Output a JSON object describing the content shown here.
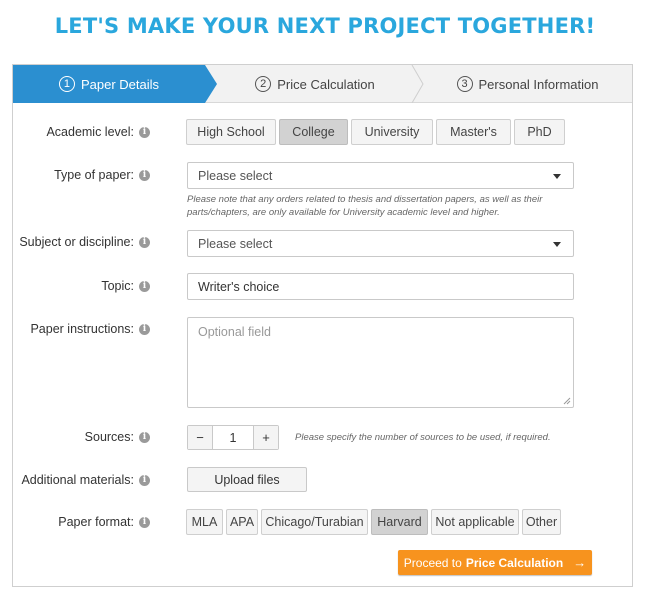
{
  "headline": "LET'S MAKE YOUR NEXT PROJECT TOGETHER!",
  "steps": [
    {
      "num": "1",
      "label": "Paper Details"
    },
    {
      "num": "2",
      "label": "Price Calculation"
    },
    {
      "num": "3",
      "label": "Personal Information"
    }
  ],
  "info_glyph": "i",
  "academic_level": {
    "label": "Academic level:",
    "options": [
      "High School",
      "College",
      "University",
      "Master's",
      "PhD"
    ],
    "selected": "College"
  },
  "type_of_paper": {
    "label": "Type of paper:",
    "value": "Please select",
    "note_line1": "Please note that any orders related to thesis and dissertation papers, as well as their",
    "note_line2": "parts/chapters, are only available for University academic level and higher."
  },
  "subject": {
    "label": "Subject or discipline:",
    "value": "Please select"
  },
  "topic": {
    "label": "Topic:",
    "value": "Writer's choice"
  },
  "instructions": {
    "label": "Paper instructions:",
    "placeholder": "Optional field"
  },
  "sources": {
    "label": "Sources:",
    "minus": "−",
    "value": "1",
    "plus": "+",
    "hint": "Please specify the number of sources to be used, if required."
  },
  "additional_materials": {
    "label": "Additional materials:",
    "button": "Upload files"
  },
  "paper_format": {
    "label": "Paper format:",
    "options": [
      "MLA",
      "APA",
      "Chicago/Turabian",
      "Harvard",
      "Not applicable",
      "Other"
    ],
    "selected": "Harvard"
  },
  "proceed": {
    "prefix": "Proceed to",
    "bold": "Price Calculation",
    "arrow": "→"
  },
  "colors": {
    "accent": "#2aa7dd",
    "step_active": "#2b8fd0",
    "cta": "#f7931e"
  }
}
